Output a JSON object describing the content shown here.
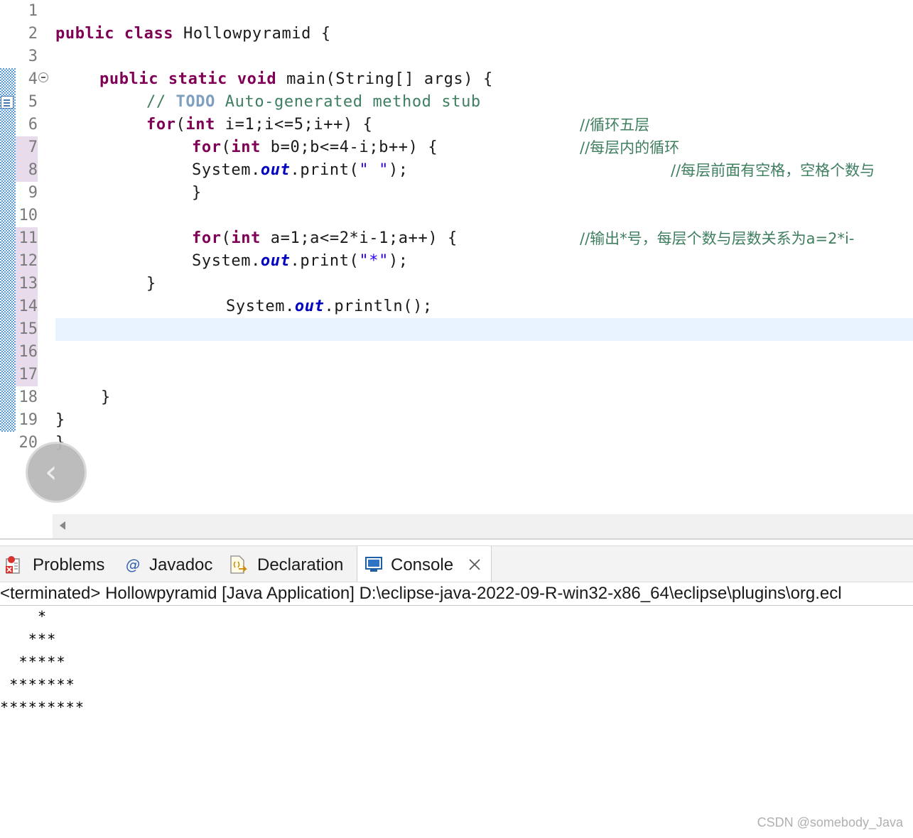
{
  "editor": {
    "line_numbers": [
      "1",
      "2",
      "3",
      "4",
      "5",
      "6",
      "7",
      "8",
      "9",
      "10",
      "11",
      "12",
      "13",
      "14",
      "15",
      "16",
      "17",
      "18",
      "19",
      "20"
    ],
    "lines": {
      "l2_kw": "public class",
      "l2_rest": " Hollowpyramid {",
      "l4_kw": "public static void",
      "l4_rest": " main(String[] args) {",
      "l5_comment": "// ",
      "l5_todo": "TODO",
      "l5_rest": " Auto-generated method stub",
      "l6_kw": "for",
      "l6_a": "(",
      "l6_int": "int",
      "l6_rest": " i=1;i<=5;i++) {",
      "l6_cmt": "//循环五层",
      "l7_kw": "for",
      "l7_a": "(",
      "l7_int": "int",
      "l7_rest": " b=0;b<=4-i;b++) {",
      "l7_cmt": "//每层内的循环",
      "l8_a": "System.",
      "l8_out": "out",
      "l8_b": ".print(",
      "l8_str": "\" \"",
      "l8_c": ");",
      "l8_cmt": "//每层前面有空格，空格个数与",
      "l9": "}",
      "l11_kw": "for",
      "l11_a": "(",
      "l11_int": "int",
      "l11_rest": " a=1;a<=2*i-1;a++) {",
      "l11_cmt": "//输出*号，每层个数与层数关系为a=2*i-",
      "l12_a": "System.",
      "l12_out": "out",
      "l12_b": ".print(",
      "l12_str": "\"*\"",
      "l12_c": ");",
      "l13": "}",
      "l14_a": "System.",
      "l14_out": "out",
      "l14_b": ".println();",
      "l18": "}",
      "l19": "}",
      "l20": "}"
    }
  },
  "tabs": [
    {
      "label": "Problems",
      "icon": "problems-icon"
    },
    {
      "label": "Javadoc",
      "icon": "javadoc-icon"
    },
    {
      "label": "Declaration",
      "icon": "declaration-icon"
    },
    {
      "label": "Console",
      "icon": "console-icon",
      "active": true
    }
  ],
  "console": {
    "status": "<terminated> Hollowpyramid [Java Application] D:\\eclipse-java-2022-09-R-win32-x86_64\\eclipse\\plugins\\org.ecl",
    "output": [
      "    *",
      "   ***",
      "  *****",
      " *******",
      "*********"
    ]
  },
  "watermark": "CSDN @somebody_Java",
  "colors": {
    "keyword": "#7f0055",
    "field": "#0000c0",
    "string": "#2a00ff",
    "comment": "#3f7f5f",
    "todo": "#7f9fbf",
    "current_line": "#e8f2fe"
  }
}
